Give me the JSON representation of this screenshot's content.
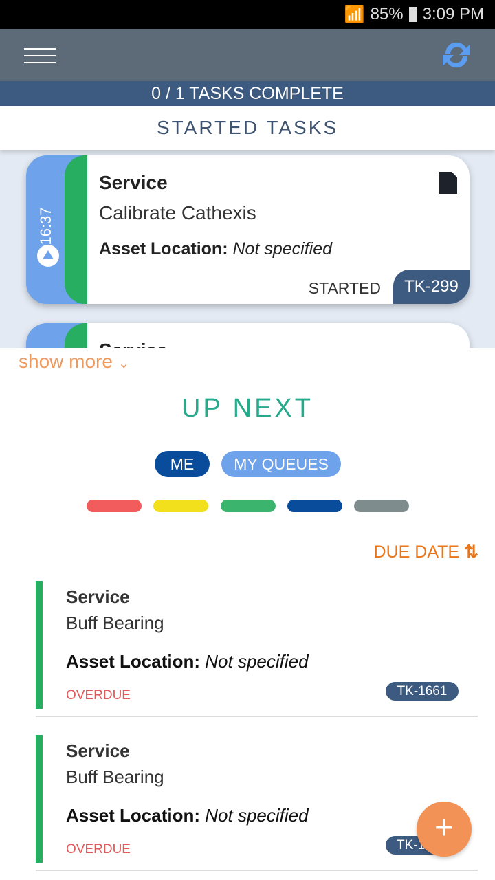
{
  "status_bar": {
    "battery": "85%",
    "time": "3:09 PM"
  },
  "header": {
    "progress": "0 / 1 TASKS COMPLETE",
    "refresh_color": "#5a9cf0"
  },
  "started": {
    "title": "STARTED TASKS",
    "cards": [
      {
        "timer": "16:37",
        "type": "Service",
        "name": "Calibrate Cathexis",
        "location_label": "Asset Location:",
        "location": "Not specified",
        "status": "STARTED",
        "ticket": "TK-299"
      },
      {
        "type": "Service"
      }
    ],
    "show_more": "show more"
  },
  "up_next": {
    "title": "UP NEXT",
    "filters": [
      {
        "label": "ME",
        "active": true
      },
      {
        "label": "MY QUEUES",
        "active": false
      }
    ],
    "priority_colors": [
      "#f25c5c",
      "#f2e01c",
      "#3bb56e",
      "#0a4c9c",
      "#7f8c8d"
    ],
    "sort_label": "DUE DATE",
    "items": [
      {
        "type": "Service",
        "name": "Buff Bearing",
        "location_label": "Asset Location:",
        "location": "Not specified",
        "status": "OVERDUE",
        "ticket": "TK-1661"
      },
      {
        "type": "Service",
        "name": "Buff Bearing",
        "location_label": "Asset Location:",
        "location": "Not specified",
        "status": "OVERDUE",
        "ticket": "TK-1"
      }
    ]
  },
  "fab": {
    "label": "+"
  }
}
